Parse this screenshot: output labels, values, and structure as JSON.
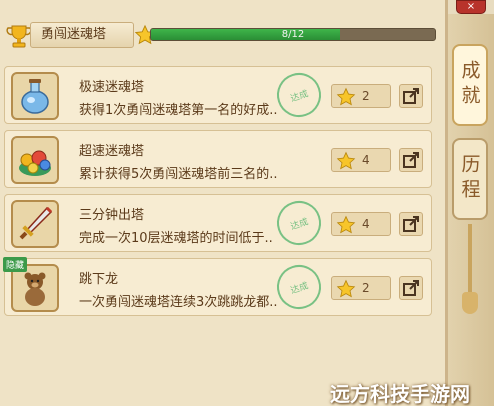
{
  "header": {
    "title": "勇闯迷魂塔",
    "progress_text": "8/12",
    "progress_fraction": 0.667
  },
  "sidebar": {
    "tabs": [
      {
        "label": "成就",
        "active": true
      },
      {
        "label": "历程",
        "active": false
      }
    ]
  },
  "achievements": [
    {
      "icon": "potion-icon",
      "title": "极速迷魂塔",
      "desc": "获得1次勇闯迷魂塔第一名的好成..",
      "stamp": "达成",
      "reward": "2",
      "badge": ""
    },
    {
      "icon": "treasure-icon",
      "title": "超速迷魂塔",
      "desc": "累计获得5次勇闯迷魂塔前三名的..",
      "stamp": "",
      "reward": "4",
      "badge": ""
    },
    {
      "icon": "sword-icon",
      "title": "三分钟出塔",
      "desc": "完成一次10层迷魂塔的时间低于..",
      "stamp": "达成",
      "reward": "4",
      "badge": ""
    },
    {
      "icon": "teddy-icon",
      "title": "跳下龙",
      "desc": "一次勇闯迷魂塔连续3次跳跳龙都..",
      "stamp": "达成",
      "reward": "2",
      "badge": "隐藏"
    }
  ],
  "watermark": "远方科技手游网",
  "close_label": "×"
}
